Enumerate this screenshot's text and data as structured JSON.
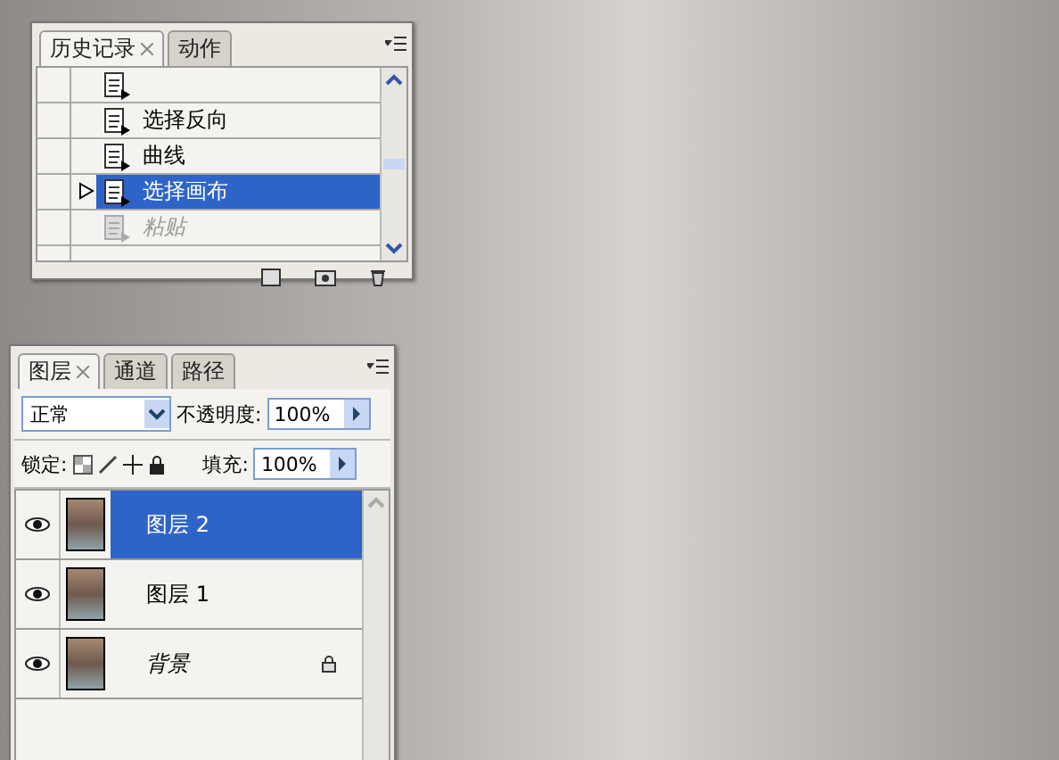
{
  "history_panel": {
    "tabs": [
      {
        "label": "历史记录",
        "selected": true,
        "closable": true
      },
      {
        "label": "动作",
        "selected": false,
        "closable": false
      }
    ],
    "items": [
      {
        "label": "选择反向",
        "selected": false,
        "disabled": false
      },
      {
        "label": "曲线",
        "selected": false,
        "disabled": false
      },
      {
        "label": "选择画布",
        "selected": true,
        "disabled": false
      },
      {
        "label": "粘贴",
        "selected": false,
        "disabled": true
      }
    ]
  },
  "layers_panel": {
    "tabs": [
      {
        "label": "图层",
        "selected": true,
        "closable": true
      },
      {
        "label": "通道",
        "selected": false,
        "closable": false
      },
      {
        "label": "路径",
        "selected": false,
        "closable": false
      }
    ],
    "blend_mode": "正常",
    "opacity_label": "不透明度:",
    "opacity": "100%",
    "lock_label": "锁定:",
    "fill_label": "填充:",
    "fill": "100%",
    "layers": [
      {
        "name": "图层 2",
        "selected": true,
        "visible": true,
        "locked": false,
        "italic": false
      },
      {
        "name": "图层 1",
        "selected": false,
        "visible": true,
        "locked": false,
        "italic": false
      },
      {
        "name": "背景",
        "selected": false,
        "visible": true,
        "locked": true,
        "italic": true
      }
    ]
  }
}
